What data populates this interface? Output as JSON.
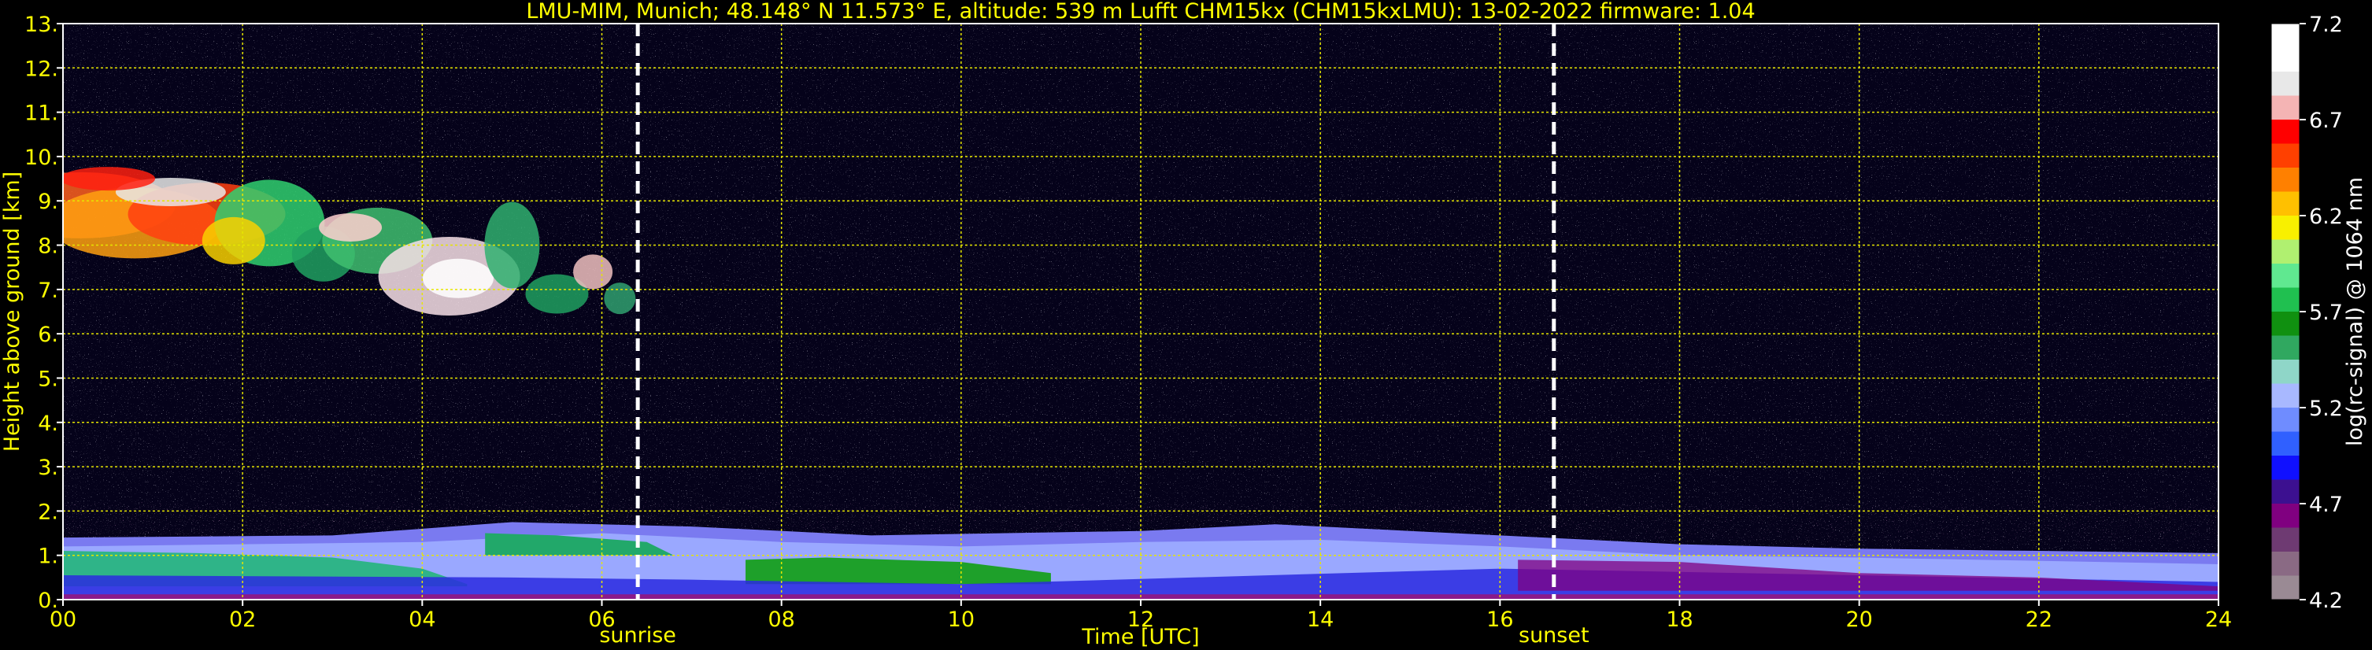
{
  "chart_data": {
    "type": "heatmap",
    "title": "LMU-MIM, Munich; 48.148° N 11.573° E, altitude: 539 m    Lufft CHM15kx (CHM15kxLMU): 13-02-2022    firmware: 1.04",
    "xlabel": "Time [UTC]",
    "ylabel": "Height above ground [km]",
    "xlim": [
      0,
      24
    ],
    "ylim": [
      0,
      13
    ],
    "x_ticks": [
      "00",
      "02",
      "04",
      "06",
      "08",
      "10",
      "12",
      "14",
      "16",
      "18",
      "20",
      "22",
      "24"
    ],
    "y_ticks": [
      "0.",
      "1.",
      "2.",
      "3.",
      "4.",
      "5.",
      "6.",
      "7.",
      "8.",
      "9.",
      "10.",
      "11.",
      "12.",
      "13."
    ],
    "grid": true,
    "colorbar": {
      "label": "log(rc-signal) @ 1064 nm",
      "range": [
        4.2,
        7.2
      ],
      "ticks": [
        "4.2",
        "4.7",
        "5.2",
        "5.7",
        "6.2",
        "6.7",
        "7.2"
      ],
      "colors": [
        "#9a8a94",
        "#8a6a84",
        "#6e3a72",
        "#800080",
        "#3c1090",
        "#1010ff",
        "#3060ff",
        "#6f8cff",
        "#a8b8ff",
        "#8fd6c8",
        "#30a860",
        "#109010",
        "#20c050",
        "#60e890",
        "#b0f070",
        "#f8f000",
        "#ffc000",
        "#ff8000",
        "#ff4000",
        "#ff0000",
        "#f4b4b4",
        "#e8e8e8",
        "#ffffff"
      ]
    },
    "events": [
      {
        "label": "sunrise",
        "time": 6.4
      },
      {
        "label": "sunset",
        "time": 16.6
      }
    ]
  }
}
